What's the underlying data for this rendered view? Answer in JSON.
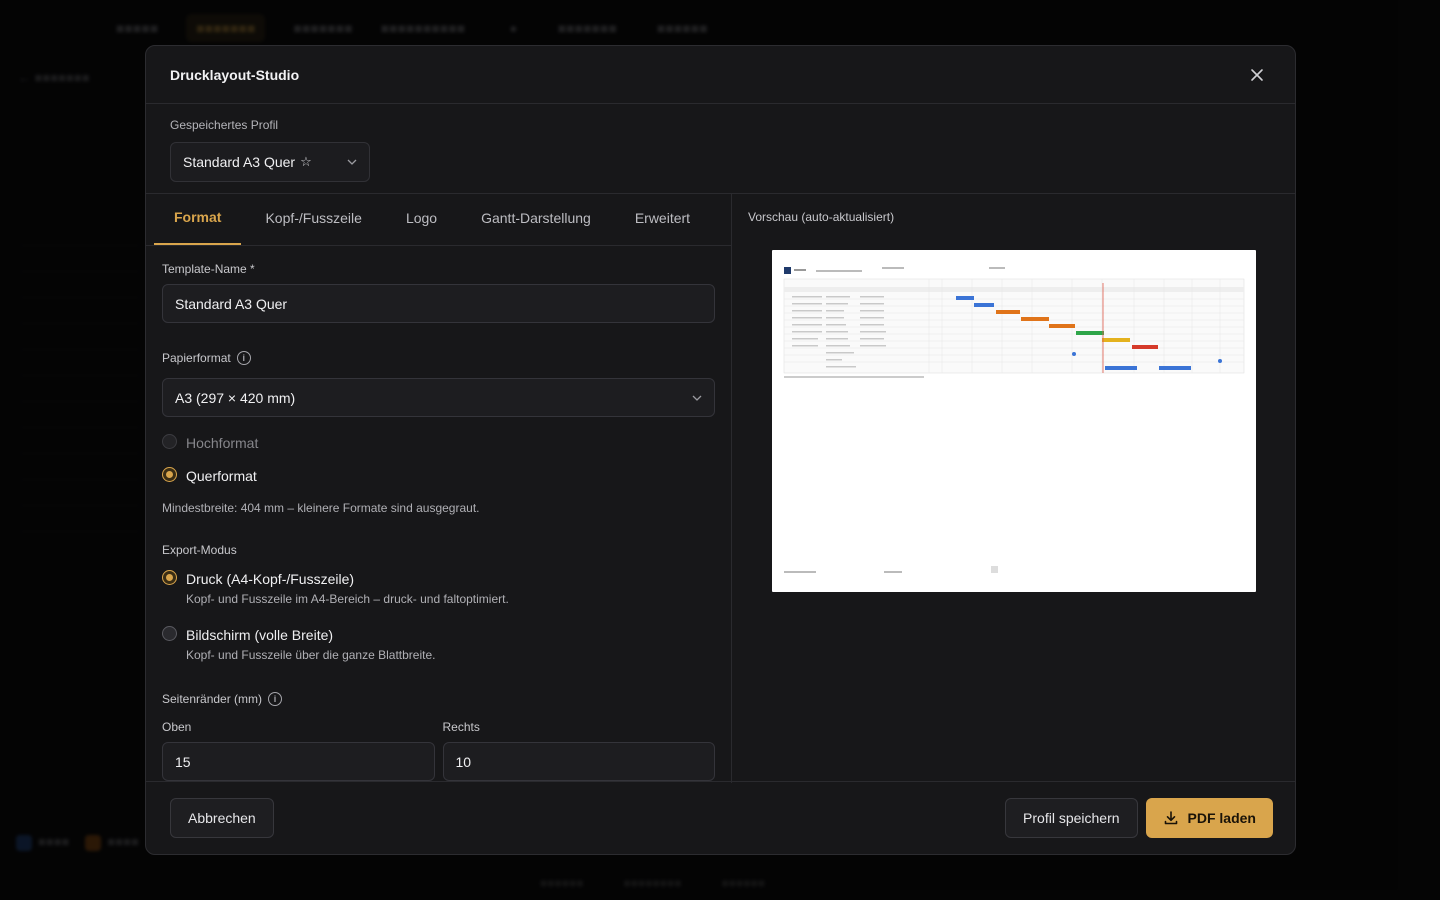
{
  "dialog": {
    "title": "Drucklayout-Studio",
    "profile_label": "Gespeichertes Profil",
    "profile_value": "Standard A3 Quer"
  },
  "tabs": [
    {
      "label": "Format",
      "active": true
    },
    {
      "label": "Kopf-/Fusszeile",
      "active": false
    },
    {
      "label": "Logo",
      "active": false
    },
    {
      "label": "Gantt-Darstellung",
      "active": false
    },
    {
      "label": "Erweitert",
      "active": false
    }
  ],
  "form": {
    "template_name_label": "Template-Name *",
    "template_name_value": "Standard A3 Quer",
    "paper_format_label": "Papierformat",
    "paper_format_value": "A3 (297 × 420 mm)",
    "orientation_portrait": "Hochformat",
    "orientation_landscape": "Querformat",
    "orientation_selected": "Querformat",
    "min_width_hint": "Mindestbreite: 404 mm – kleinere Formate sind ausgegraut.",
    "export_mode_label": "Export-Modus",
    "export_print_label": "Druck (A4-Kopf-/Fusszeile)",
    "export_print_hint": "Kopf- und Fusszeile im A4-Bereich – druck- und faltoptimiert.",
    "export_screen_label": "Bildschirm (volle Breite)",
    "export_screen_hint": "Kopf- und Fusszeile über die ganze Blattbreite.",
    "export_selected": "Druck (A4-Kopf-/Fusszeile)",
    "margins_label": "Seitenränder (mm)",
    "margin_top_label": "Oben",
    "margin_top_value": "15",
    "margin_right_label": "Rechts",
    "margin_right_value": "10"
  },
  "preview": {
    "label": "Vorschau (auto-aktualisiert)"
  },
  "footer": {
    "cancel_label": "Abbrechen",
    "save_profile_label": "Profil speichern",
    "download_pdf_label": "PDF laden"
  },
  "colors": {
    "accent": "#d9a54c",
    "dialog_bg": "#171719",
    "page_bg": "#0c0c0d"
  }
}
